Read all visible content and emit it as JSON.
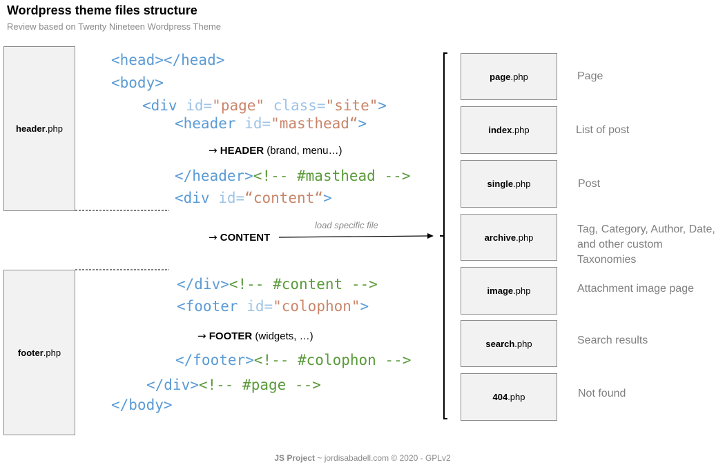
{
  "title": "Wordpress  theme files structure",
  "subtitle": "Review based on Twenty Nineteen Wordpress Theme",
  "left_files": {
    "header": {
      "name": "header",
      "ext": ".php"
    },
    "footer": {
      "name": "footer",
      "ext": ".php"
    }
  },
  "code": {
    "head": "<head></head>",
    "body_open": "<body>",
    "div_page": {
      "open": "<div",
      "id_attr": "id=",
      "id_val": "\"page\"",
      "class_attr": "class=",
      "class_val": "\"site\"",
      "close": ">"
    },
    "header_open": {
      "open": "<header",
      "id_attr": "id=",
      "id_val": "\"masthead“",
      "close": ">"
    },
    "header_close": {
      "tag": "</header>",
      "comment": "<!-- #masthead -->"
    },
    "div_content": {
      "open": "<div",
      "id_attr": "id=",
      "id_val": "“content“",
      "close": ">"
    },
    "div_close": {
      "tag": "</div>",
      "comment": "<!-- #content -->"
    },
    "footer_open": {
      "open": "<footer",
      "id_attr": "id=",
      "id_val": "\"colophon\"",
      "close": ">"
    },
    "footer_close": {
      "tag": "</footer>",
      "comment": "<!-- #colophon -->"
    },
    "div_page_close": {
      "tag": "</div>",
      "comment": "<!-- #page -->"
    },
    "body_close": "</body>"
  },
  "notes": {
    "header": {
      "arrow": "→",
      "keyword": "HEADER",
      "rest": " (brand, menu…)"
    },
    "content": {
      "arrow": "→",
      "keyword": "CONTENT"
    },
    "footer": {
      "arrow": "→",
      "keyword": "FOOTER",
      "rest": " (widgets, …)"
    }
  },
  "load_label": "load specific file",
  "templates": [
    {
      "name": "page",
      "ext": ".php",
      "description": "Page"
    },
    {
      "name": "index",
      "ext": ".php",
      "description": "List of post"
    },
    {
      "name": "single",
      "ext": ".php",
      "description": "Post"
    },
    {
      "name": "archive",
      "ext": ".php",
      "description": "Tag, Category, Author, Date, and other custom Taxonomies"
    },
    {
      "name": "image",
      "ext": ".php",
      "description": "Attachment image page"
    },
    {
      "name": "search",
      "ext": ".php",
      "description": "Search results"
    },
    {
      "name": "404",
      "ext": ".php",
      "description": "Not found"
    }
  ],
  "credit": {
    "project": "JS Project",
    "rest": " ~ jordisabadell.com © 2020 - GPLv2"
  }
}
